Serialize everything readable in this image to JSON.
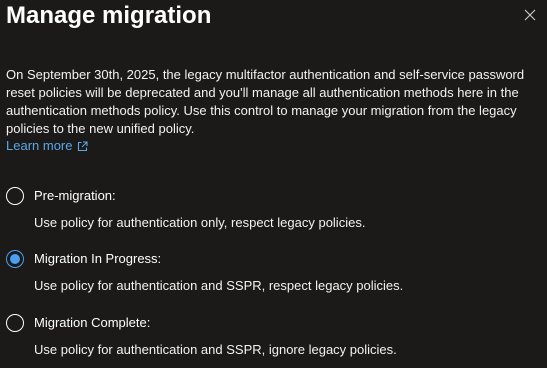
{
  "panel": {
    "title": "Manage migration",
    "close_icon": "close-icon"
  },
  "description": {
    "text": "On September 30th, 2025, the legacy multifactor authentication and self-service password reset policies will be deprecated and you'll manage all authentication methods here in the authentication methods policy. Use this control to manage your migration from the legacy policies to the new unified policy.",
    "learn_more_label": "Learn more",
    "learn_more_icon": "external-link-icon"
  },
  "accent_color": "#4aa0f0",
  "link_color": "#5aa7e7",
  "options": [
    {
      "label": "Pre-migration:",
      "description": "Use policy for authentication only, respect legacy policies.",
      "selected": false
    },
    {
      "label": "Migration In Progress:",
      "description": "Use policy for authentication and SSPR, respect legacy policies.",
      "selected": true
    },
    {
      "label": "Migration Complete:",
      "description": "Use policy for authentication and SSPR, ignore legacy policies.",
      "selected": false
    }
  ]
}
